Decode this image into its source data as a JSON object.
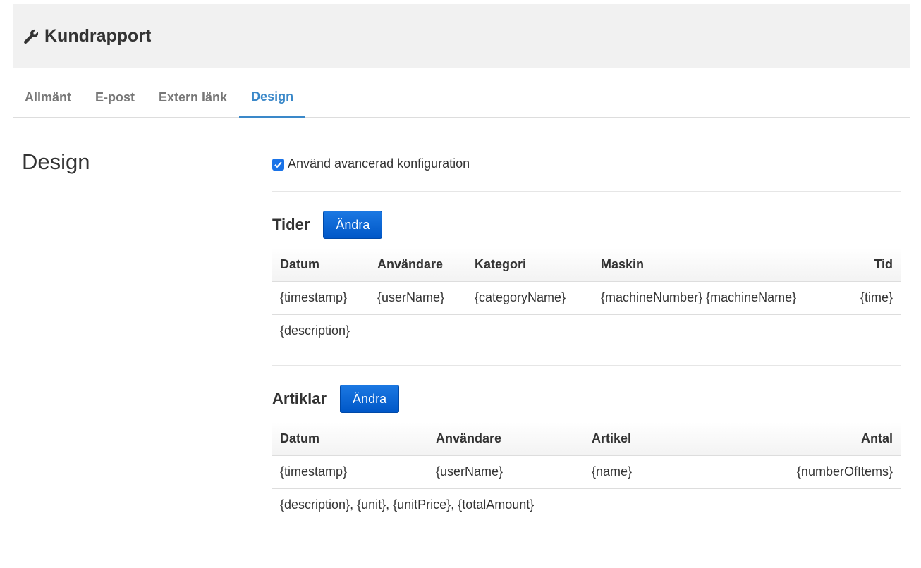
{
  "header": {
    "title": "Kundrapport",
    "icon": "wrench-icon"
  },
  "tabs": [
    {
      "label": "Allmänt",
      "active": false
    },
    {
      "label": "E-post",
      "active": false
    },
    {
      "label": "Extern länk",
      "active": false
    },
    {
      "label": "Design",
      "active": true
    }
  ],
  "section": {
    "title": "Design"
  },
  "advanced": {
    "label": "Använd avancerad konfiguration",
    "checked": true
  },
  "times": {
    "title": "Tider",
    "button": "Ändra",
    "columns": [
      "Datum",
      "Användare",
      "Kategori",
      "Maskin",
      "Tid"
    ],
    "row": [
      "{timestamp}",
      "{userName}",
      "{categoryName}",
      "{machineNumber} {machineName}",
      "{time}"
    ],
    "description": "{description}"
  },
  "articles": {
    "title": "Artiklar",
    "button": "Ändra",
    "columns": [
      "Datum",
      "Användare",
      "Artikel",
      "Antal"
    ],
    "row": [
      "{timestamp}",
      "{userName}",
      "{name}",
      "{numberOfItems}"
    ],
    "description": "{description}, {unit}, {unitPrice}, {totalAmount}"
  },
  "colors": {
    "accent": "#3a88c9",
    "button": "#0a66d6",
    "header_bg": "#f1f1f1"
  }
}
